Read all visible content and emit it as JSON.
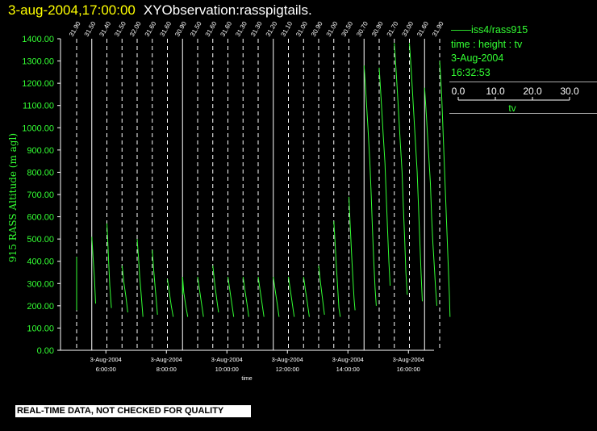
{
  "header": {
    "time": "3-aug-2004,17:00:00",
    "name": "XYObservation:rasspigtails."
  },
  "legend": {
    "series_label": "iss4/rass915",
    "type_label": "time : height : tv",
    "date": "3-Aug-2004",
    "time": "16:32:53",
    "scale_ticks": [
      "0.0",
      "10.0",
      "20.0",
      "30.0"
    ],
    "scale_label": "tv"
  },
  "disclaimer": "REAL-TIME DATA, NOT CHECKED FOR QUALITY",
  "colors": {
    "background": "#000000",
    "trace": "#33ff33",
    "axis": "#ffffff",
    "title_time": "#ffff00"
  },
  "chart_data": {
    "type": "line",
    "ylabel": "915 RASS Altitude (m agl)",
    "xlabel": "time",
    "ylim": [
      0,
      1400
    ],
    "yticks": [
      "0.00",
      "100.00",
      "200.00",
      "300.00",
      "400.00",
      "500.00",
      "600.00",
      "700.00",
      "800.00",
      "900.00",
      "1000.00",
      "1100.00",
      "1200.00",
      "1300.00",
      "1400.00"
    ],
    "xlim_hours": [
      4.5,
      17.0
    ],
    "xtick_hours": [
      6,
      8,
      10,
      12,
      14,
      16
    ],
    "xtick_dates": [
      "3-Aug-2004",
      "3-Aug-2004",
      "3-Aug-2004",
      "3-Aug-2004",
      "3-Aug-2004",
      "3-Aug-2004"
    ],
    "xtick_times": [
      "6:00:00",
      "8:00:00",
      "10:00:00",
      "12:00:00",
      "14:00:00",
      "16:00:00"
    ],
    "profile_hours": [
      4.5,
      5.0,
      5.5,
      6.0,
      6.5,
      7.0,
      7.5,
      8.0,
      8.5,
      9.0,
      9.5,
      10.0,
      10.5,
      11.0,
      11.5,
      12.0,
      12.5,
      13.0,
      13.5,
      14.0,
      14.5,
      15.0,
      15.5,
      16.0,
      16.5
    ],
    "profile_values": [
      "31.90",
      "31.50",
      "31.40",
      "31.50",
      "32.00",
      "31.60",
      "31.60",
      "30.90",
      "31.50",
      "31.60",
      "31.60",
      "31.30",
      "31.30",
      "31.20",
      "31.10",
      "31.00",
      "30.90",
      "31.00",
      "30.50",
      "30.70",
      "30.90",
      "31.70",
      "33.00",
      "31.60",
      "31.90"
    ],
    "solid_lines_hours": [
      5.0,
      8.0,
      11.0,
      14.0,
      16.0
    ],
    "trace_scale": "tv",
    "traces": [
      {
        "time_hour": 4.5,
        "points": [
          [
            0.0,
            180
          ],
          [
            0.0,
            420
          ]
        ]
      },
      {
        "time_hour": 5.0,
        "points": [
          [
            0.0,
            510
          ],
          [
            0.2,
            420
          ],
          [
            0.4,
            330
          ],
          [
            0.6,
            210
          ]
        ]
      },
      {
        "time_hour": 5.5,
        "points": [
          [
            0.0,
            570
          ],
          [
            0.15,
            480
          ],
          [
            0.3,
            380
          ],
          [
            0.45,
            290
          ],
          [
            0.7,
            190
          ]
        ]
      },
      {
        "time_hour": 6.0,
        "points": [
          [
            0.0,
            380
          ],
          [
            0.3,
            300
          ],
          [
            0.6,
            240
          ],
          [
            0.9,
            170
          ]
        ]
      },
      {
        "time_hour": 6.5,
        "points": [
          [
            0.0,
            500
          ],
          [
            0.2,
            420
          ],
          [
            0.4,
            330
          ],
          [
            0.6,
            260
          ],
          [
            0.9,
            150
          ]
        ]
      },
      {
        "time_hour": 7.0,
        "points": [
          [
            0.0,
            450
          ],
          [
            0.2,
            370
          ],
          [
            0.4,
            300
          ],
          [
            0.6,
            230
          ],
          [
            0.8,
            160
          ]
        ]
      },
      {
        "time_hour": 7.5,
        "points": [
          [
            0.0,
            320
          ],
          [
            0.3,
            260
          ],
          [
            0.6,
            200
          ],
          [
            0.9,
            150
          ]
        ]
      },
      {
        "time_hour": 8.0,
        "points": [
          [
            0.0,
            250
          ],
          [
            0.0,
            330
          ],
          [
            0.2,
            260
          ],
          [
            0.5,
            200
          ],
          [
            0.8,
            150
          ]
        ]
      },
      {
        "time_hour": 8.5,
        "points": [
          [
            0.0,
            330
          ],
          [
            0.3,
            270
          ],
          [
            0.6,
            210
          ],
          [
            0.9,
            150
          ]
        ]
      },
      {
        "time_hour": 9.0,
        "points": [
          [
            0.0,
            380
          ],
          [
            0.3,
            300
          ],
          [
            0.6,
            230
          ],
          [
            0.9,
            170
          ]
        ]
      },
      {
        "time_hour": 9.5,
        "points": [
          [
            0.0,
            330
          ],
          [
            0.3,
            270
          ],
          [
            0.6,
            210
          ],
          [
            0.9,
            150
          ]
        ]
      },
      {
        "time_hour": 10.0,
        "points": [
          [
            0.0,
            330
          ],
          [
            0.3,
            270
          ],
          [
            0.6,
            210
          ],
          [
            0.9,
            150
          ]
        ]
      },
      {
        "time_hour": 10.5,
        "points": [
          [
            0.0,
            330
          ],
          [
            0.3,
            270
          ],
          [
            0.6,
            210
          ],
          [
            0.9,
            150
          ]
        ]
      },
      {
        "time_hour": 11.0,
        "points": [
          [
            0.0,
            330
          ],
          [
            0.3,
            270
          ],
          [
            0.6,
            210
          ],
          [
            0.9,
            150
          ]
        ]
      },
      {
        "time_hour": 11.5,
        "points": [
          [
            0.0,
            330
          ],
          [
            0.3,
            270
          ],
          [
            0.6,
            210
          ],
          [
            0.9,
            150
          ]
        ]
      },
      {
        "time_hour": 12.0,
        "points": [
          [
            0.0,
            330
          ],
          [
            0.3,
            270
          ],
          [
            0.6,
            210
          ],
          [
            0.9,
            150
          ]
        ]
      },
      {
        "time_hour": 12.5,
        "points": [
          [
            0.0,
            380
          ],
          [
            0.3,
            300
          ],
          [
            0.6,
            230
          ],
          [
            0.9,
            160
          ]
        ]
      },
      {
        "time_hour": 13.0,
        "points": [
          [
            0.0,
            580
          ],
          [
            0.2,
            480
          ],
          [
            0.4,
            380
          ],
          [
            0.6,
            280
          ],
          [
            0.8,
            190
          ],
          [
            1.0,
            150
          ]
        ]
      },
      {
        "time_hour": 13.5,
        "points": [
          [
            0.0,
            690
          ],
          [
            0.2,
            560
          ],
          [
            0.4,
            440
          ],
          [
            0.6,
            330
          ],
          [
            0.8,
            230
          ],
          [
            0.95,
            180
          ]
        ]
      },
      {
        "time_hour": 14.0,
        "points": [
          [
            0.0,
            1280
          ],
          [
            0.3,
            1150
          ],
          [
            0.6,
            1000
          ],
          [
            0.9,
            850
          ],
          [
            1.1,
            700
          ],
          [
            1.3,
            550
          ],
          [
            1.5,
            400
          ],
          [
            1.7,
            280
          ],
          [
            1.9,
            200
          ]
        ]
      },
      {
        "time_hour": 14.5,
        "points": [
          [
            0.0,
            1270
          ],
          [
            0.3,
            1130
          ],
          [
            0.6,
            980
          ],
          [
            0.9,
            840
          ],
          [
            1.1,
            690
          ],
          [
            1.3,
            540
          ],
          [
            1.5,
            400
          ],
          [
            1.7,
            290
          ]
        ]
      },
      {
        "time_hour": 15.0,
        "points": [
          [
            0.0,
            1380
          ],
          [
            0.3,
            1250
          ],
          [
            0.6,
            1100
          ],
          [
            0.9,
            950
          ],
          [
            1.2,
            800
          ],
          [
            1.4,
            650
          ],
          [
            1.6,
            500
          ],
          [
            1.8,
            350
          ],
          [
            2.0,
            250
          ]
        ]
      },
      {
        "time_hour": 15.5,
        "points": [
          [
            0.0,
            1380
          ],
          [
            0.3,
            1250
          ],
          [
            0.6,
            1100
          ],
          [
            0.9,
            950
          ],
          [
            1.2,
            800
          ],
          [
            1.4,
            650
          ],
          [
            1.6,
            500
          ],
          [
            1.8,
            350
          ],
          [
            2.0,
            220
          ]
        ]
      },
      {
        "time_hour": 16.0,
        "points": [
          [
            0.0,
            1180
          ],
          [
            0.3,
            1050
          ],
          [
            0.6,
            900
          ],
          [
            0.9,
            750
          ],
          [
            1.1,
            600
          ],
          [
            1.3,
            480
          ],
          [
            1.5,
            380
          ],
          [
            1.7,
            280
          ],
          [
            1.9,
            200
          ]
        ]
      },
      {
        "time_hour": 16.5,
        "points": [
          [
            0.0,
            1300
          ],
          [
            0.3,
            1150
          ],
          [
            0.5,
            1000
          ],
          [
            0.7,
            850
          ],
          [
            0.9,
            700
          ],
          [
            1.1,
            550
          ],
          [
            1.3,
            400
          ],
          [
            1.5,
            250
          ],
          [
            1.6,
            150
          ]
        ]
      }
    ]
  }
}
